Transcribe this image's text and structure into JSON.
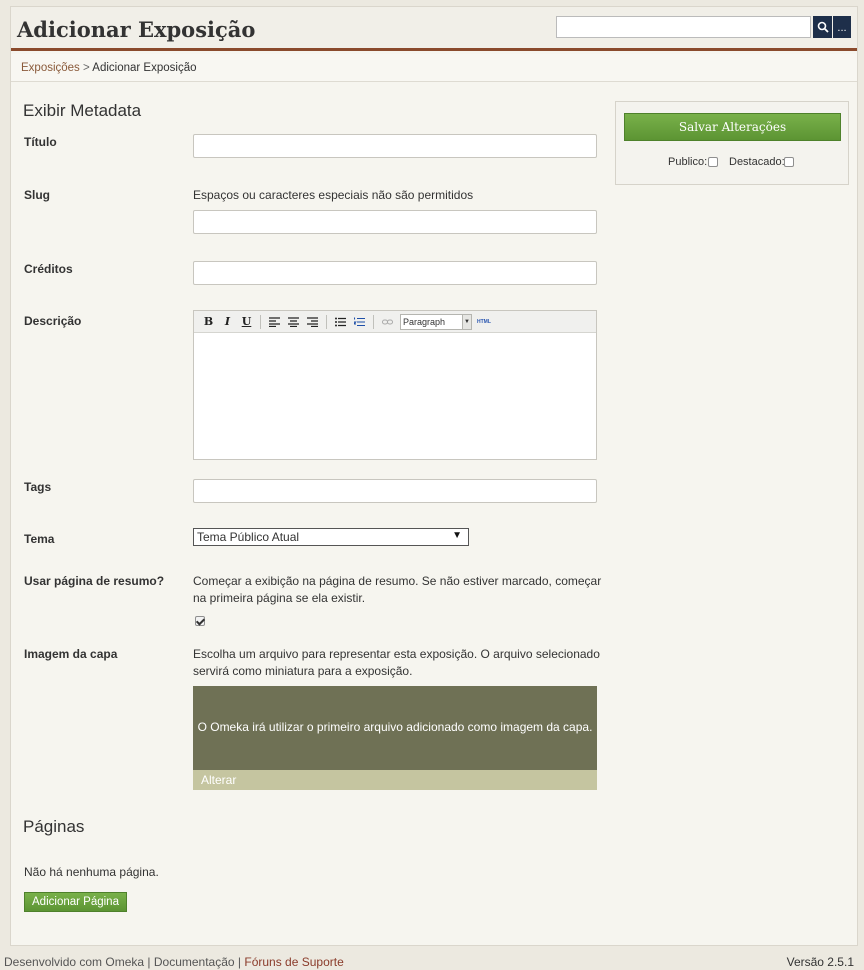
{
  "header": {
    "title": "Adicionar Exposição",
    "search_placeholder": "",
    "search_icon": "search-icon",
    "advanced_label": "..."
  },
  "breadcrumb": {
    "parent": "Exposições",
    "separator": " > ",
    "current": "Adicionar Exposição"
  },
  "form": {
    "section_title": "Exibir Metadata",
    "titulo_label": "Título",
    "slug_label": "Slug",
    "slug_help": "Espaços ou caracteres especiais não são permitidos",
    "creditos_label": "Créditos",
    "descricao_label": "Descrição",
    "editor": {
      "bold": "B",
      "italic": "I",
      "underline": "U",
      "format_value": "Paragraph",
      "html_label": "HTML"
    },
    "tags_label": "Tags",
    "tema_label": "Tema",
    "tema_value": "Tema Público Atual",
    "summary_label": "Usar página de resumo?",
    "summary_help": "Começar a exibição na página de resumo. Se não estiver marcado, começar na primeira página se ela existir.",
    "summary_checked": true,
    "cover_label": "Imagem da capa",
    "cover_help": "Escolha um arquivo para representar esta exposição. O arquivo selecionado servirá como miniatura para a exposição.",
    "cover_message": "O Omeka irá utilizar o primeiro arquivo adicionado como imagem da capa.",
    "cover_change": "Alterar"
  },
  "pages": {
    "title": "Páginas",
    "empty": "Não há nenhuma página.",
    "add_button": "Adicionar Página"
  },
  "sidebar": {
    "save_button": "Salvar Alterações",
    "public_label": "Publico:",
    "featured_label": "Destacado:"
  },
  "footer": {
    "powered": "Desenvolvido com Omeka",
    "sep": " | ",
    "docs": "Documentação",
    "forums": "Fóruns de Suporte",
    "version": "Versão 2.5.1"
  },
  "colors": {
    "accent_green": "#5c9433",
    "header_rule": "#8a4a2c",
    "search_button": "#1e2f4a",
    "cover_bg": "#6f7155"
  }
}
